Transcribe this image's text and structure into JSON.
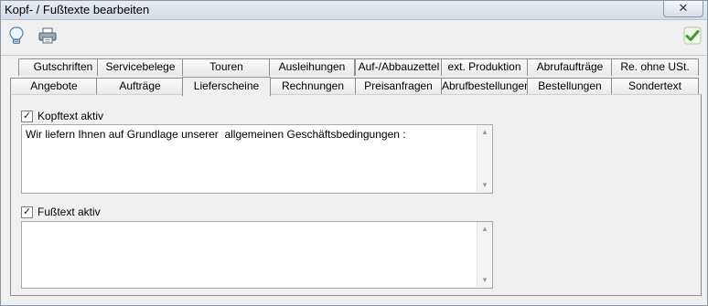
{
  "window": {
    "title": "Kopf- / Fußtexte bearbeiten",
    "close_symbol": "✕"
  },
  "toolbar": {
    "buttons": [
      {
        "name": "bulb-icon"
      },
      {
        "name": "printer-icon"
      },
      {
        "name": "check-icon"
      }
    ]
  },
  "tabs": {
    "row1": [
      "Gutschriften",
      "Servicebelege",
      "Touren",
      "Ausleihungen",
      "Auf-/Abbauzettel",
      "ext. Produktion",
      "Abrufaufträge",
      "Re. ohne USt."
    ],
    "row2": [
      "Angebote",
      "Aufträge",
      "Lieferscheine",
      "Rechnungen",
      "Preisanfragen",
      "Abrufbestellungen",
      "Bestellungen",
      "Sondertext"
    ],
    "active": "Lieferscheine"
  },
  "header_text": {
    "checkbox_label": "Kopftext aktiv",
    "checked": true,
    "value": "Wir liefern Ihnen auf Grundlage unserer  allgemeinen Geschäftsbedingungen :"
  },
  "footer_text": {
    "checkbox_label": "Fußtext aktiv",
    "checked": true,
    "value": ""
  },
  "colors": {
    "accent_check": "#3c9a2b"
  }
}
